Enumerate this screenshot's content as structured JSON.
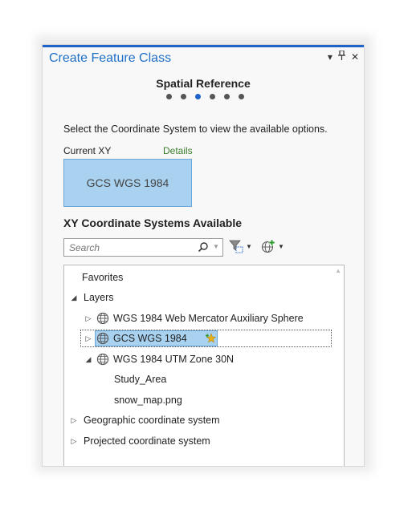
{
  "pane": {
    "title": "Create Feature Class",
    "controls": {
      "options_icon": "▾",
      "pin_icon": "pin",
      "close_icon": "✕"
    }
  },
  "wizard": {
    "step_title": "Spatial Reference",
    "step_count": 6,
    "active_step": 3
  },
  "instruction": "Select the Coordinate System to view the available options.",
  "current": {
    "label": "Current XY",
    "details_link": "Details",
    "value": "GCS WGS 1984"
  },
  "available": {
    "heading": "XY Coordinate Systems Available",
    "search_placeholder": "Search",
    "filter_tool": "filter-icon",
    "add_tool": "add-globe-icon"
  },
  "tree": {
    "favorites": "Favorites",
    "layers": "Layers",
    "layer_items": [
      "WGS 1984 Web Mercator Auxiliary Sphere",
      "GCS WGS 1984",
      "WGS 1984 UTM Zone 30N"
    ],
    "utm_children": [
      "Study_Area",
      "snow_map.png"
    ],
    "geographic": "Geographic coordinate system",
    "projected": "Projected coordinate system"
  },
  "colors": {
    "accent": "#1e64c8",
    "link": "#3a7d2c",
    "selection": "#a8d2f0"
  }
}
